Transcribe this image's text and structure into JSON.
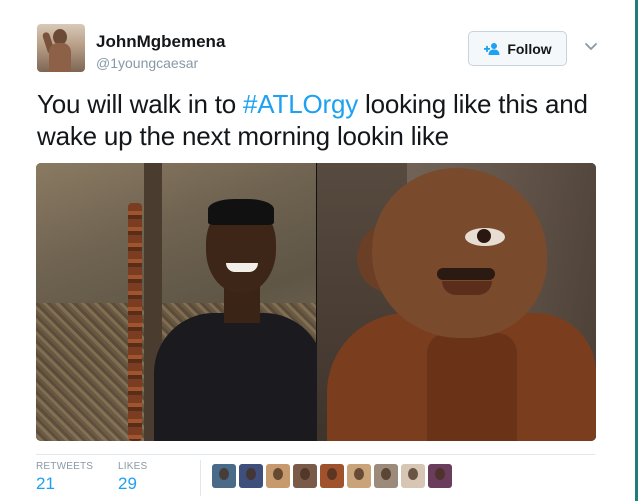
{
  "tweet": {
    "user": {
      "name": "JohnMgbemena",
      "handle": "@1youngcaesar"
    },
    "follow_label": "Follow",
    "text_before": "You will walk in to ",
    "hashtag": "#ATLOrgy",
    "text_after": " looking like this and wake up the next morning lookin like",
    "stats": {
      "retweets_label": "RETWEETS",
      "retweets_value": "21",
      "likes_label": "LIKES",
      "likes_value": "29"
    },
    "likers": [
      {
        "color": "#4a6a8a"
      },
      {
        "color": "#3d4f7a"
      },
      {
        "color": "#c69a6d"
      },
      {
        "color": "#7a5a48"
      },
      {
        "color": "#a0522d"
      },
      {
        "color": "#c9a37a"
      },
      {
        "color": "#9c8a7a"
      },
      {
        "color": "#d8c6b4"
      },
      {
        "color": "#6b3d5c"
      }
    ]
  },
  "colors": {
    "accent": "#1da1f2",
    "text": "#14171a",
    "muted": "#8899a6"
  },
  "icons": {
    "follow": "add-user-icon",
    "caret": "chevron-down-icon"
  }
}
